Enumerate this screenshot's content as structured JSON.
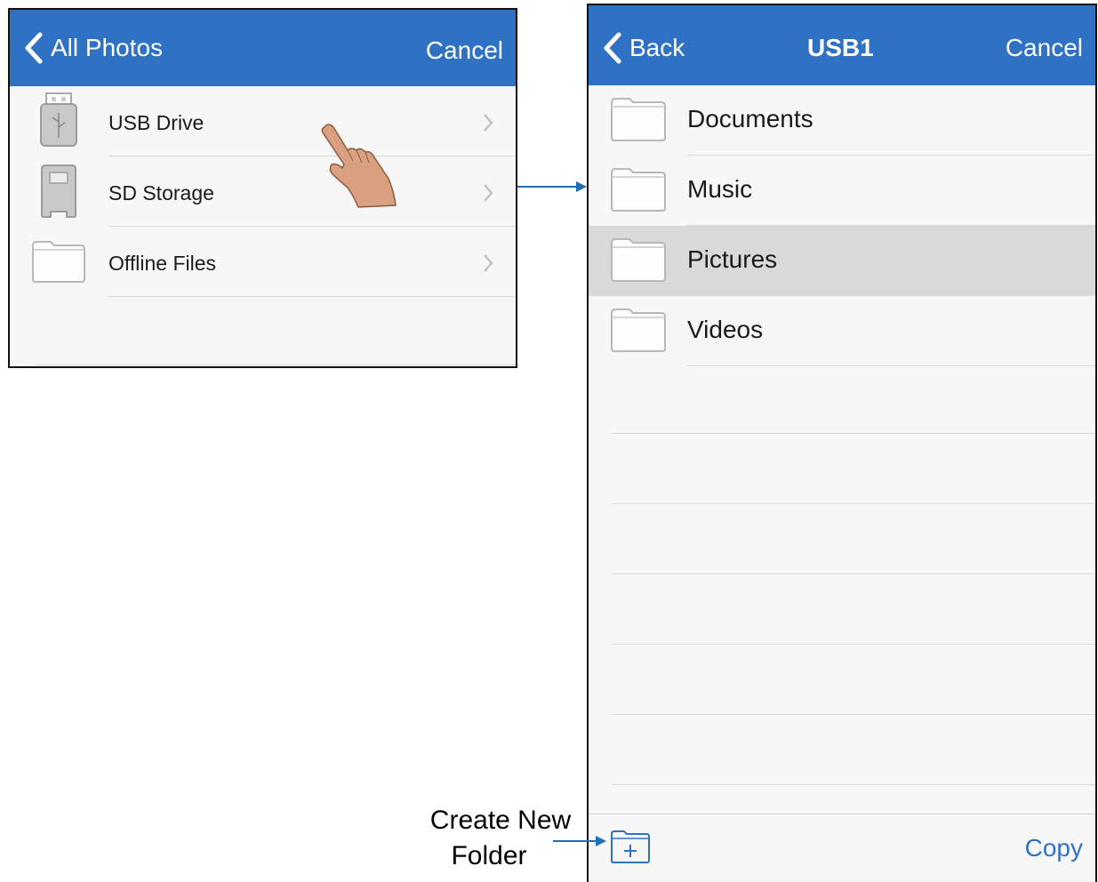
{
  "left_screen": {
    "back_label": "All Photos",
    "cancel_label": "Cancel",
    "items": [
      {
        "label": "USB Drive",
        "icon": "usb-drive-icon"
      },
      {
        "label": "SD Storage",
        "icon": "sd-card-icon"
      },
      {
        "label": "Offline Files",
        "icon": "folder-icon"
      }
    ]
  },
  "right_screen": {
    "back_label": "Back",
    "title": "USB1",
    "cancel_label": "Cancel",
    "folders": [
      {
        "label": "Documents",
        "selected": false
      },
      {
        "label": "Music",
        "selected": false
      },
      {
        "label": "Pictures",
        "selected": true
      },
      {
        "label": "Videos",
        "selected": false
      }
    ],
    "copy_label": "Copy",
    "new_folder_icon": "folder-plus-icon"
  },
  "annotation": {
    "create_new_folder_line1": "Create New",
    "create_new_folder_line2": "Folder"
  },
  "colors": {
    "navbar": "#2f72c4",
    "selected_row": "#d9d9d9",
    "arrow": "#1f6fb5"
  }
}
